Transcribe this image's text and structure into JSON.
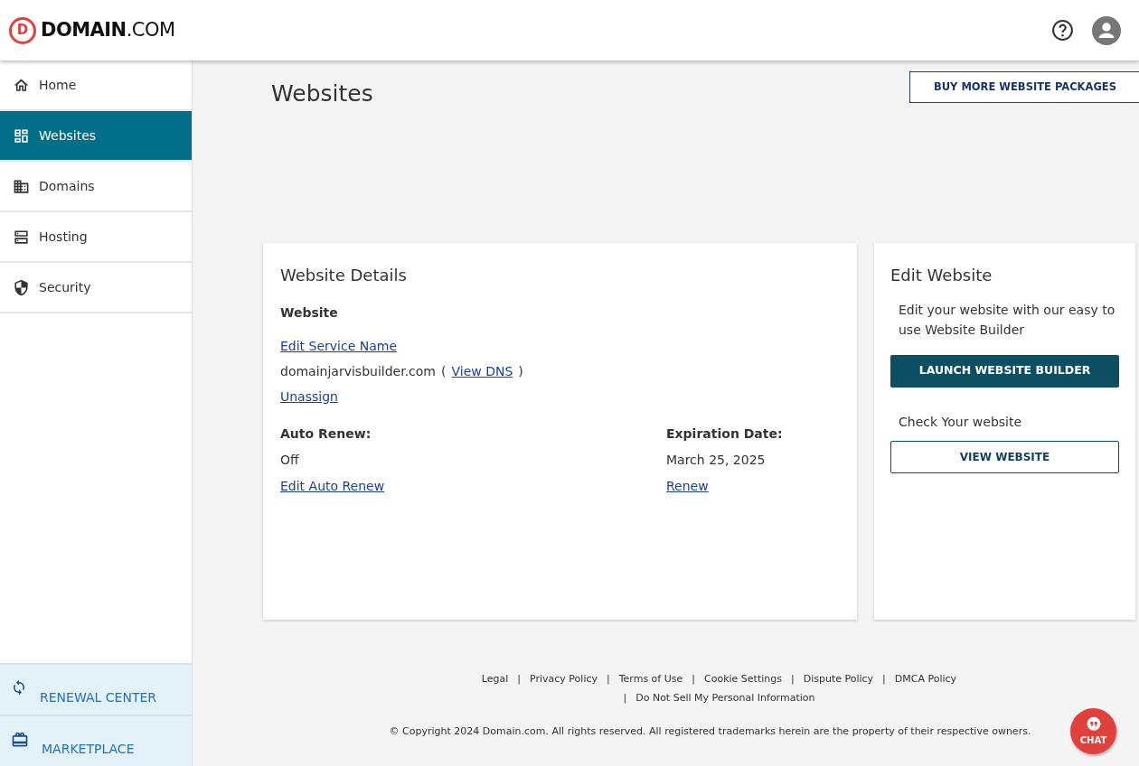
{
  "header": {
    "logo": {
      "mark": "D",
      "brand": "DOMAIN",
      "suffix": ".COM"
    }
  },
  "sidebar": {
    "items": [
      {
        "label": "Home",
        "selected": false
      },
      {
        "label": "Websites",
        "selected": true
      },
      {
        "label": "Domains",
        "selected": false
      },
      {
        "label": "Hosting",
        "selected": false
      },
      {
        "label": "Security",
        "selected": false
      }
    ],
    "bottom_items": [
      {
        "label": "RENEWAL CENTER"
      },
      {
        "label": "MARKETPLACE"
      }
    ]
  },
  "page": {
    "title": "Websites",
    "action_button": "BUY MORE WEBSITE PACKAGES"
  },
  "details_card": {
    "title": "Website Details",
    "section_label": "Website",
    "edit_name_link": "Edit Service Name",
    "domain": "domainjarvisbuilder.com",
    "open_paren": "(",
    "view_dns_link": "View DNS",
    "close_paren": ")",
    "unassign_link": "Unassign",
    "auto_renew": {
      "label": "Auto Renew:",
      "value": "Off",
      "link": "Edit Auto Renew"
    },
    "expiration": {
      "label": "Expiration Date:",
      "value": "March 25, 2025",
      "link": "Renew"
    }
  },
  "edit_card": {
    "title": "Edit Website",
    "description": "Edit your website with our easy to use Website Builder",
    "launch_button": "LAUNCH WEBSITE BUILDER",
    "check_label": "Check Your website",
    "view_button": "VIEW WEBSITE"
  },
  "footer": {
    "separator": "|",
    "link_rows": [
      [
        "Legal",
        "Privacy Policy",
        "Terms of Use",
        "Cookie Settings",
        "Dispute Policy",
        "DMCA Policy"
      ],
      [
        "Do Not Sell My Personal Information"
      ]
    ],
    "copyright": "© Copyright 2024 Domain.com. All rights reserved. All registered trademarks herein are the property of their respective owners."
  },
  "chat": {
    "label": "CHAT"
  }
}
